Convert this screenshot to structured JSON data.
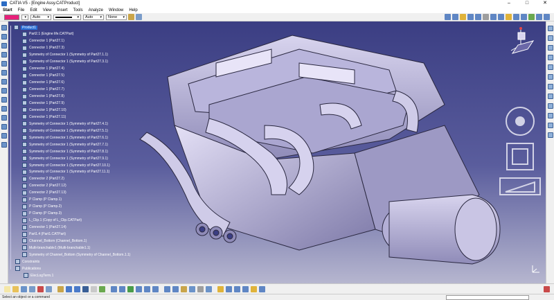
{
  "window": {
    "title": "CATIA V5 - [Engine Assy.CATProduct]",
    "controls": [
      "–",
      "□",
      "✕"
    ]
  },
  "menu": [
    "Start",
    "File",
    "Edit",
    "View",
    "Insert",
    "Tools",
    "Analyze",
    "Window",
    "Help"
  ],
  "properties": {
    "color_hex": "#e8207a",
    "transparency": "Auto",
    "line_thickness": "Auto",
    "line_type": "None"
  },
  "tree": [
    "Product1",
    "Part2.1 (Engine life.CATPart)",
    "Connector 1 (Part27.1)",
    "Connector 1 (Part27.3)",
    "Symmetry of Connector 1 (Symmetry of Part27.1.1)",
    "Symmetry of Connector 1 (Symmetry of Part27.3.1)",
    "Connector 1 (Part27.4)",
    "Connector 1 (Part27.5)",
    "Connector 1 (Part27.6)",
    "Connector 1 (Part27.7)",
    "Connector 1 (Part27.8)",
    "Connector 1 (Part27.9)",
    "Connector 1 (Part27.10)",
    "Connector 1 (Part27.11)",
    "Symmetry of Connector 1 (Symmetry of Part27.4.1)",
    "Symmetry of Connector 1 (Symmetry of Part27.5.1)",
    "Symmetry of Connector 1 (Symmetry of Part27.6.1)",
    "Symmetry of Connector 1 (Symmetry of Part27.7.1)",
    "Symmetry of Connector 1 (Symmetry of Part27.8.1)",
    "Symmetry of Connector 1 (Symmetry of Part27.9.1)",
    "Symmetry of Connector 1 (Symmetry of Part27.10.1)",
    "Symmetry of Connector 1 (Symmetry of Part27.11.1)",
    "Connector 2 (Part27.2)",
    "Connector 2 (Part27.12)",
    "Connector 2 (Part27.13)",
    "P Clamp (P Clamp.1)",
    "P Clamp (P Clamp.2)",
    "P Clamp (P Clamp.3)",
    "L_Clip.1 (Copy of L_Clip.CATPart)",
    "Connector 1 (Part27.14)",
    "Part1.4 (Part1.CATPart)",
    "Channel_Bottom (Channel_Bottom.1)",
    "Multi-branchable1 (Multi-branchable1.1)",
    "Symmetry of Channel_Bottom (Symmetry of Channel_Bottom.1.1)",
    "Constraints",
    "Publications",
    "ElecLogTerm.1"
  ],
  "status": {
    "message": "Select an object or a command"
  }
}
